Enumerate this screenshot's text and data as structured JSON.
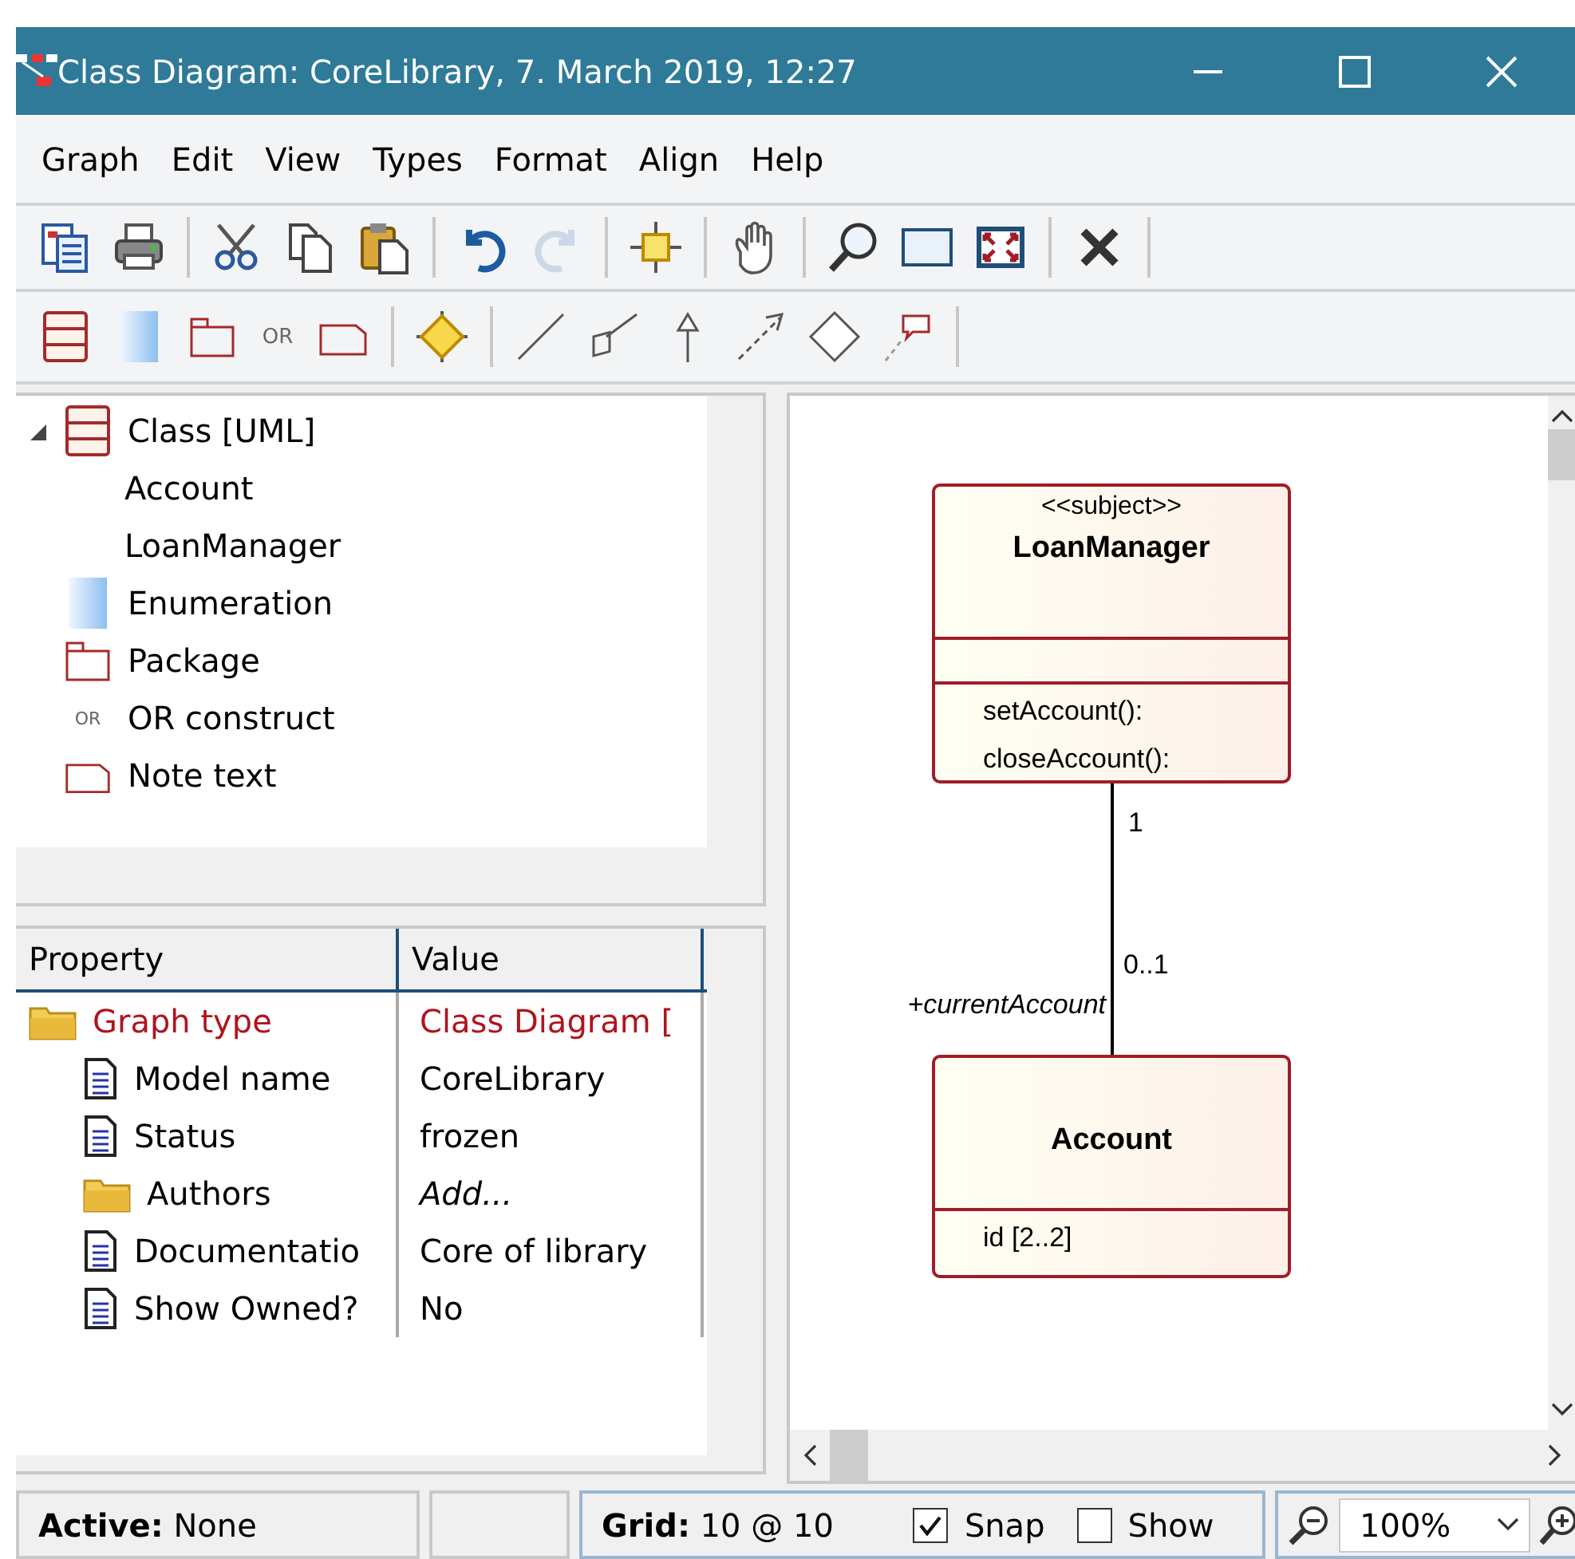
{
  "window": {
    "title": "Class Diagram: CoreLibrary, 7. March 2019, 12:27"
  },
  "menu": [
    "Graph",
    "Edit",
    "View",
    "Types",
    "Format",
    "Align",
    "Help"
  ],
  "toolbar_1": [
    {
      "kind": "button",
      "disabled": false
    },
    {
      "kind": "button",
      "disabled": false
    },
    {
      "kind": "separator"
    },
    {
      "kind": "button",
      "disabled": false
    },
    {
      "kind": "button",
      "disabled": false
    },
    {
      "kind": "button",
      "disabled": false
    },
    {
      "kind": "separator"
    },
    {
      "kind": "button",
      "disabled": false
    },
    {
      "kind": "button",
      "disabled": true
    },
    {
      "kind": "separator"
    },
    {
      "kind": "button",
      "disabled": false
    },
    {
      "kind": "separator"
    },
    {
      "kind": "button",
      "disabled": false
    },
    {
      "kind": "separator"
    },
    {
      "kind": "button",
      "disabled": false
    },
    {
      "kind": "button",
      "disabled": false
    },
    {
      "kind": "button",
      "disabled": false
    },
    {
      "kind": "separator"
    },
    {
      "kind": "button",
      "disabled": false
    },
    {
      "kind": "separator"
    }
  ],
  "toolbar_2": [
    {
      "kind": "button"
    },
    {
      "kind": "button"
    },
    {
      "kind": "button"
    },
    {
      "kind": "text",
      "label": "OR"
    },
    {
      "kind": "button"
    },
    {
      "kind": "separator"
    },
    {
      "kind": "button"
    },
    {
      "kind": "separator"
    },
    {
      "kind": "button"
    },
    {
      "kind": "button"
    },
    {
      "kind": "button"
    },
    {
      "kind": "button"
    },
    {
      "kind": "button"
    },
    {
      "kind": "button"
    },
    {
      "kind": "separator"
    }
  ],
  "type_tree": [
    {
      "kind": "class",
      "label": "Class [UML]",
      "expanded": true,
      "children": [
        {
          "label": "Account"
        },
        {
          "label": "LoanManager"
        }
      ]
    },
    {
      "kind": "enumeration",
      "label": "Enumeration"
    },
    {
      "kind": "package",
      "label": "Package"
    },
    {
      "kind": "text",
      "badge": "OR",
      "label": "OR construct"
    },
    {
      "kind": "note",
      "label": "Note text"
    }
  ],
  "properties": {
    "columns": [
      "Property",
      "Value"
    ],
    "rows": [
      {
        "kind": "folder",
        "name": "Graph type",
        "value": "Class Diagram [",
        "highlighted": true,
        "children": [
          {
            "kind": "document",
            "name": "Model name",
            "value": "CoreLibrary",
            "highlighted": false
          },
          {
            "kind": "document",
            "name": "Status",
            "value": "frozen",
            "highlighted": false
          },
          {
            "kind": "folder",
            "name": "Authors",
            "placeholder": "Add...",
            "highlighted": false
          },
          {
            "kind": "document",
            "name": "Documentatio",
            "value": "Core of library",
            "highlighted": false
          },
          {
            "kind": "document",
            "name": "Show Owned?",
            "value": "No",
            "highlighted": false
          }
        ]
      }
    ]
  },
  "diagram": {
    "classes": [
      {
        "stereotype": "<<subject>>",
        "name": "LoanManager",
        "operations": [
          "setAccount():",
          "closeAccount():"
        ]
      },
      {
        "name": "Account",
        "attributes": [
          "id [2..2]"
        ]
      }
    ],
    "associations": [
      {
        "source_multiplicity": "1",
        "target_multiplicity": "0..1",
        "target_role": "+currentAccount"
      }
    ]
  },
  "status_bar": {
    "active": "**Active:** None",
    "grid": "**Grid:** 10 @ 10",
    "options": [
      {
        "label": "Snap",
        "checked": true
      },
      {
        "label": "Show",
        "checked": false
      }
    ],
    "zoom": "100%"
  }
}
